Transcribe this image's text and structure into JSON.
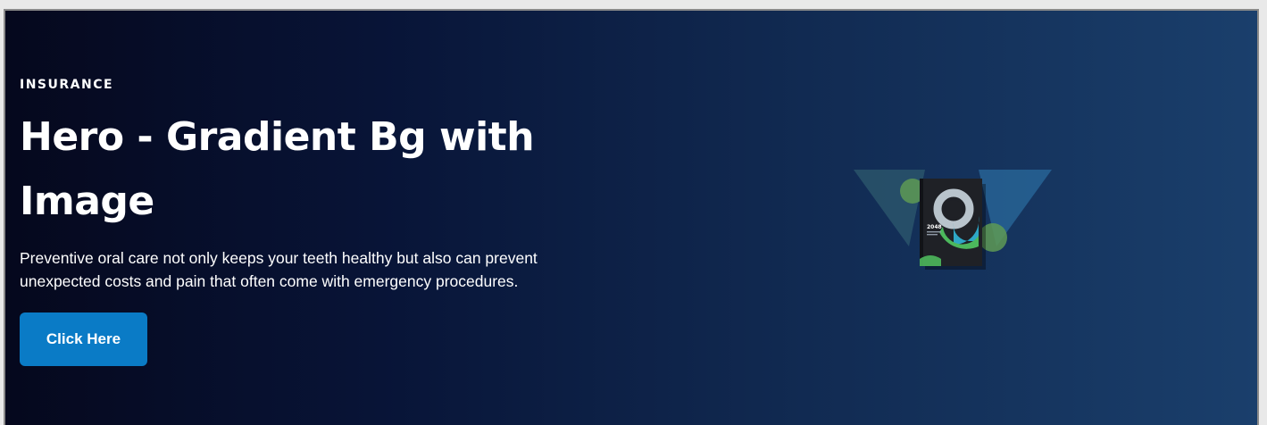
{
  "hero": {
    "eyebrow": "INSURANCE",
    "title": "Hero - Gradient Bg with Image",
    "description": "Preventive oral care not only keeps your teeth healthy but also can prevent unexpected costs and pain that often come with emergency procedures.",
    "cta_label": "Click Here",
    "image": {
      "icon": "report-book-illustration",
      "cover_text": "2048"
    }
  },
  "colors": {
    "gradient_start": "#05081d",
    "gradient_end": "#1a3f6c",
    "button": "#0a7bc6",
    "text": "#ffffff"
  }
}
